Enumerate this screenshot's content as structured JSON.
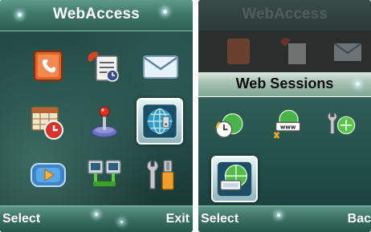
{
  "left_screen": {
    "title": "WebAccess",
    "softkeys": {
      "left": "Select",
      "right": "Exit"
    },
    "menu_icons": [
      "phonebook-icon",
      "call-log-icon",
      "messages-icon",
      "organizer-icon",
      "games-icon",
      "webaccess-icon",
      "media-icon",
      "connectivity-icon",
      "settings-icon"
    ],
    "selected_icon": "webaccess-icon"
  },
  "right_screen": {
    "background_title": "WebAccess",
    "popup_title": "Web Sessions",
    "softkeys": {
      "left": "Select",
      "right": "Bac"
    },
    "session_icons": [
      "session-history-icon",
      "go-to-url-icon",
      "web-settings-icon",
      "web-session-icon"
    ],
    "selected_icon": "web-session-icon"
  },
  "colors": {
    "screen_bg": "#1c3a37",
    "bar_light": "#5f9a8a",
    "bar_dark": "#2e5f52",
    "selection_border": "#ffffff"
  }
}
